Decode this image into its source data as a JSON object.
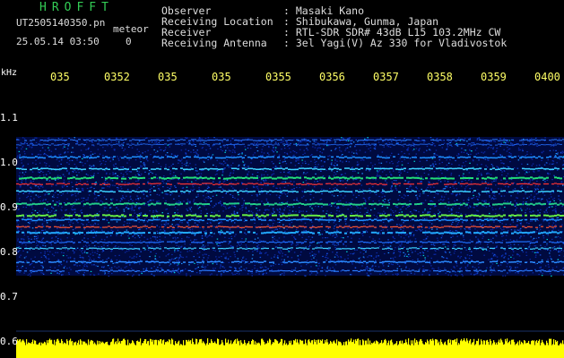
{
  "header": {
    "brand": "HROFFT",
    "filename": "UT2505140350.pn",
    "mode": "meteor",
    "datetime": "25.05.14 03:50",
    "count": "0"
  },
  "meta": {
    "observer_label": "Observer",
    "observer_value": ": Masaki Kano",
    "location_label": "Receiving Location",
    "location_value": ": Shibukawa, Gunma, Japan",
    "receiver_label": "Receiver",
    "receiver_value": ": RTL-SDR SDR# 43dB L15 103.2MHz CW",
    "antenna_label": "Receiving Antenna",
    "antenna_value": ": 3el Yagi(V) Az 330 for Vladivostok"
  },
  "axes": {
    "unit": "kHz",
    "time_ticks": [
      "035",
      "0352",
      "035",
      "035",
      "0355",
      "0356",
      "0357",
      "0358",
      "0359",
      "0400"
    ],
    "freq_ticks": [
      "1.1",
      "1.0",
      "0.9",
      "0.8",
      "0.7",
      "0.6"
    ]
  },
  "colors": {
    "background": "#000000",
    "tick_text": "#ffff66",
    "brand_text": "#33cc55",
    "noise_floor": "#ffff00",
    "echo_line": "#ff3333"
  }
}
